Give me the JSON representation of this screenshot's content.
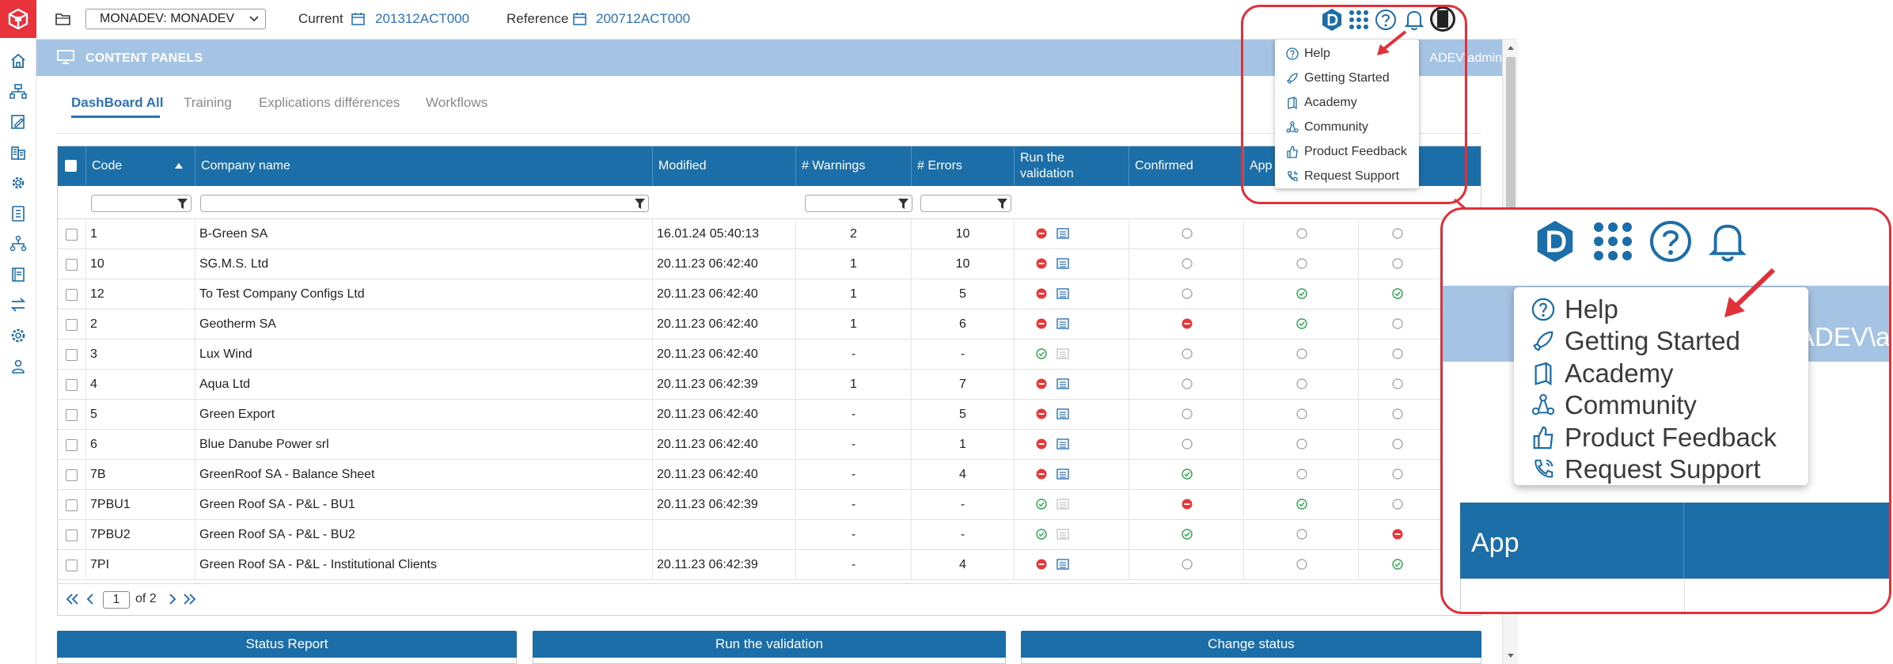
{
  "topbar": {
    "workspace_value": "MONADEV: MONADEV",
    "current_label": "Current",
    "current_value": "201312ACT000",
    "reference_label": "Reference",
    "reference_value": "200712ACT000"
  },
  "panel": {
    "title": "CONTENT PANELS",
    "user": "ADEV\\admin"
  },
  "tabs": [
    "DashBoard All",
    "Training",
    "Explications différences",
    "Workflows"
  ],
  "grid": {
    "columns": [
      "Code",
      "Company name",
      "Modified",
      "# Warnings",
      "# Errors",
      "Run the validation",
      "Confirmed",
      "App"
    ],
    "rows": [
      {
        "code": "1",
        "name": "B-Green SA",
        "modified": "16.01.24 05:40:13",
        "warnings": "2",
        "errors": "10",
        "run": "error",
        "report": true,
        "confirmed": "empty",
        "approved": "empty",
        "last": "empty"
      },
      {
        "code": "10",
        "name": "SG.M.S. Ltd",
        "modified": "20.11.23 06:42:40",
        "warnings": "1",
        "errors": "10",
        "run": "error",
        "report": true,
        "confirmed": "empty",
        "approved": "empty",
        "last": "empty"
      },
      {
        "code": "12",
        "name": "To Test Company Configs Ltd",
        "modified": "20.11.23 06:42:40",
        "warnings": "1",
        "errors": "5",
        "run": "error",
        "report": true,
        "confirmed": "empty",
        "approved": "ok",
        "last": "ok"
      },
      {
        "code": "2",
        "name": "Geotherm SA",
        "modified": "20.11.23 06:42:40",
        "warnings": "1",
        "errors": "6",
        "run": "error",
        "report": true,
        "confirmed": "error",
        "approved": "ok",
        "last": "empty"
      },
      {
        "code": "3",
        "name": "Lux Wind",
        "modified": "20.11.23 06:42:40",
        "warnings": "-",
        "errors": "-",
        "run": "ok",
        "report": false,
        "confirmed": "empty",
        "approved": "empty",
        "last": "empty"
      },
      {
        "code": "4",
        "name": "Aqua Ltd",
        "modified": "20.11.23 06:42:39",
        "warnings": "1",
        "errors": "7",
        "run": "error",
        "report": true,
        "confirmed": "empty",
        "approved": "empty",
        "last": "empty"
      },
      {
        "code": "5",
        "name": "Green Export",
        "modified": "20.11.23 06:42:40",
        "warnings": "-",
        "errors": "5",
        "run": "error",
        "report": true,
        "confirmed": "empty",
        "approved": "empty",
        "last": "empty"
      },
      {
        "code": "6",
        "name": "Blue Danube Power srl",
        "modified": "20.11.23 06:42:40",
        "warnings": "-",
        "errors": "1",
        "run": "error",
        "report": true,
        "confirmed": "empty",
        "approved": "empty",
        "last": "empty"
      },
      {
        "code": "7B",
        "name": "GreenRoof SA - Balance Sheet",
        "modified": "20.11.23 06:42:40",
        "warnings": "-",
        "errors": "4",
        "run": "error",
        "report": true,
        "confirmed": "ok",
        "approved": "empty",
        "last": "empty"
      },
      {
        "code": "7PBU1",
        "name": "Green Roof SA - P&L - BU1",
        "modified": "20.11.23 06:42:39",
        "warnings": "-",
        "errors": "-",
        "run": "ok",
        "report": false,
        "confirmed": "error",
        "approved": "ok",
        "last": "empty"
      },
      {
        "code": "7PBU2",
        "name": "Green Roof SA - P&L - BU2",
        "modified": "",
        "warnings": "-",
        "errors": "-",
        "run": "ok",
        "report": false,
        "confirmed": "ok",
        "approved": "empty",
        "last": "error"
      },
      {
        "code": "7PI",
        "name": "Green Roof SA - P&L - Institutional Clients",
        "modified": "20.11.23 06:42:39",
        "warnings": "-",
        "errors": "4",
        "run": "error",
        "report": true,
        "confirmed": "empty",
        "approved": "empty",
        "last": "ok"
      }
    ]
  },
  "pager": {
    "page": "1",
    "of_text": "of 2"
  },
  "widgets": [
    "Status Report",
    "Run the validation",
    "Change status"
  ],
  "help_menu": [
    "Help",
    "Getting Started",
    "Academy",
    "Community",
    "Product Feedback",
    "Request Support"
  ],
  "zoom": {
    "user_fragment": "ADEV\\a",
    "header_fragment": "App"
  },
  "colors": {
    "brand": "#e8323c",
    "header_blue": "#1c6ea8",
    "panel_blue": "#a5c3e3",
    "link_blue": "#2d73b8",
    "status_red": "#e5383b",
    "status_green": "#2ea44f",
    "callout": "#e0303a"
  },
  "icons": {
    "sidebar": [
      "home-icon",
      "org-chart-icon",
      "edit-sheet-icon",
      "buildings-icon",
      "gear-cog-icon",
      "calculator-icon",
      "hierarchy-icon",
      "book-icon",
      "transfer-icon",
      "settings-icon",
      "users-icon"
    ],
    "top": [
      "d-logo-icon",
      "apps-grid-icon",
      "help-icon",
      "bell-icon",
      "avatar"
    ]
  }
}
